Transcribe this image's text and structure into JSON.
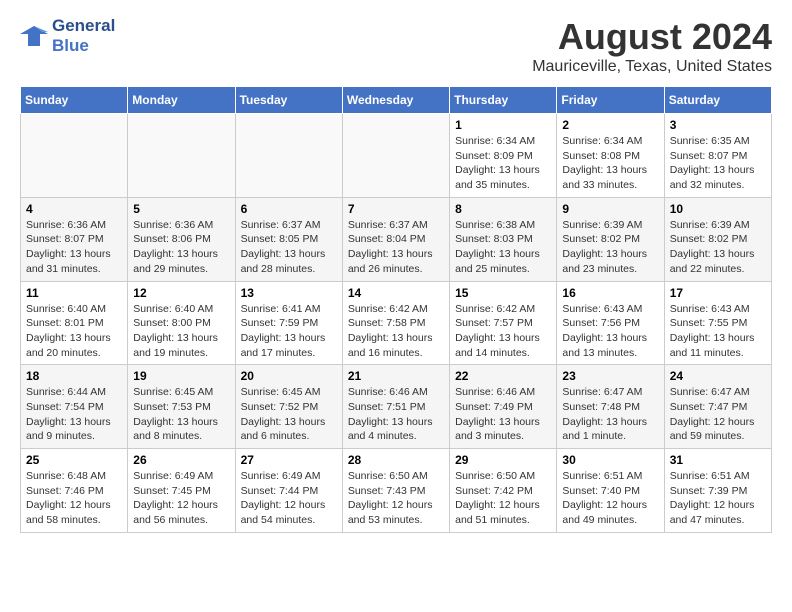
{
  "logo": {
    "line1": "General",
    "line2": "Blue"
  },
  "title": "August 2024",
  "subtitle": "Mauriceville, Texas, United States",
  "weekdays": [
    "Sunday",
    "Monday",
    "Tuesday",
    "Wednesday",
    "Thursday",
    "Friday",
    "Saturday"
  ],
  "weeks": [
    [
      {
        "day": "",
        "info": ""
      },
      {
        "day": "",
        "info": ""
      },
      {
        "day": "",
        "info": ""
      },
      {
        "day": "",
        "info": ""
      },
      {
        "day": "1",
        "info": "Sunrise: 6:34 AM\nSunset: 8:09 PM\nDaylight: 13 hours\nand 35 minutes."
      },
      {
        "day": "2",
        "info": "Sunrise: 6:34 AM\nSunset: 8:08 PM\nDaylight: 13 hours\nand 33 minutes."
      },
      {
        "day": "3",
        "info": "Sunrise: 6:35 AM\nSunset: 8:07 PM\nDaylight: 13 hours\nand 32 minutes."
      }
    ],
    [
      {
        "day": "4",
        "info": "Sunrise: 6:36 AM\nSunset: 8:07 PM\nDaylight: 13 hours\nand 31 minutes."
      },
      {
        "day": "5",
        "info": "Sunrise: 6:36 AM\nSunset: 8:06 PM\nDaylight: 13 hours\nand 29 minutes."
      },
      {
        "day": "6",
        "info": "Sunrise: 6:37 AM\nSunset: 8:05 PM\nDaylight: 13 hours\nand 28 minutes."
      },
      {
        "day": "7",
        "info": "Sunrise: 6:37 AM\nSunset: 8:04 PM\nDaylight: 13 hours\nand 26 minutes."
      },
      {
        "day": "8",
        "info": "Sunrise: 6:38 AM\nSunset: 8:03 PM\nDaylight: 13 hours\nand 25 minutes."
      },
      {
        "day": "9",
        "info": "Sunrise: 6:39 AM\nSunset: 8:02 PM\nDaylight: 13 hours\nand 23 minutes."
      },
      {
        "day": "10",
        "info": "Sunrise: 6:39 AM\nSunset: 8:02 PM\nDaylight: 13 hours\nand 22 minutes."
      }
    ],
    [
      {
        "day": "11",
        "info": "Sunrise: 6:40 AM\nSunset: 8:01 PM\nDaylight: 13 hours\nand 20 minutes."
      },
      {
        "day": "12",
        "info": "Sunrise: 6:40 AM\nSunset: 8:00 PM\nDaylight: 13 hours\nand 19 minutes."
      },
      {
        "day": "13",
        "info": "Sunrise: 6:41 AM\nSunset: 7:59 PM\nDaylight: 13 hours\nand 17 minutes."
      },
      {
        "day": "14",
        "info": "Sunrise: 6:42 AM\nSunset: 7:58 PM\nDaylight: 13 hours\nand 16 minutes."
      },
      {
        "day": "15",
        "info": "Sunrise: 6:42 AM\nSunset: 7:57 PM\nDaylight: 13 hours\nand 14 minutes."
      },
      {
        "day": "16",
        "info": "Sunrise: 6:43 AM\nSunset: 7:56 PM\nDaylight: 13 hours\nand 13 minutes."
      },
      {
        "day": "17",
        "info": "Sunrise: 6:43 AM\nSunset: 7:55 PM\nDaylight: 13 hours\nand 11 minutes."
      }
    ],
    [
      {
        "day": "18",
        "info": "Sunrise: 6:44 AM\nSunset: 7:54 PM\nDaylight: 13 hours\nand 9 minutes."
      },
      {
        "day": "19",
        "info": "Sunrise: 6:45 AM\nSunset: 7:53 PM\nDaylight: 13 hours\nand 8 minutes."
      },
      {
        "day": "20",
        "info": "Sunrise: 6:45 AM\nSunset: 7:52 PM\nDaylight: 13 hours\nand 6 minutes."
      },
      {
        "day": "21",
        "info": "Sunrise: 6:46 AM\nSunset: 7:51 PM\nDaylight: 13 hours\nand 4 minutes."
      },
      {
        "day": "22",
        "info": "Sunrise: 6:46 AM\nSunset: 7:49 PM\nDaylight: 13 hours\nand 3 minutes."
      },
      {
        "day": "23",
        "info": "Sunrise: 6:47 AM\nSunset: 7:48 PM\nDaylight: 13 hours\nand 1 minute."
      },
      {
        "day": "24",
        "info": "Sunrise: 6:47 AM\nSunset: 7:47 PM\nDaylight: 12 hours\nand 59 minutes."
      }
    ],
    [
      {
        "day": "25",
        "info": "Sunrise: 6:48 AM\nSunset: 7:46 PM\nDaylight: 12 hours\nand 58 minutes."
      },
      {
        "day": "26",
        "info": "Sunrise: 6:49 AM\nSunset: 7:45 PM\nDaylight: 12 hours\nand 56 minutes."
      },
      {
        "day": "27",
        "info": "Sunrise: 6:49 AM\nSunset: 7:44 PM\nDaylight: 12 hours\nand 54 minutes."
      },
      {
        "day": "28",
        "info": "Sunrise: 6:50 AM\nSunset: 7:43 PM\nDaylight: 12 hours\nand 53 minutes."
      },
      {
        "day": "29",
        "info": "Sunrise: 6:50 AM\nSunset: 7:42 PM\nDaylight: 12 hours\nand 51 minutes."
      },
      {
        "day": "30",
        "info": "Sunrise: 6:51 AM\nSunset: 7:40 PM\nDaylight: 12 hours\nand 49 minutes."
      },
      {
        "day": "31",
        "info": "Sunrise: 6:51 AM\nSunset: 7:39 PM\nDaylight: 12 hours\nand 47 minutes."
      }
    ]
  ]
}
